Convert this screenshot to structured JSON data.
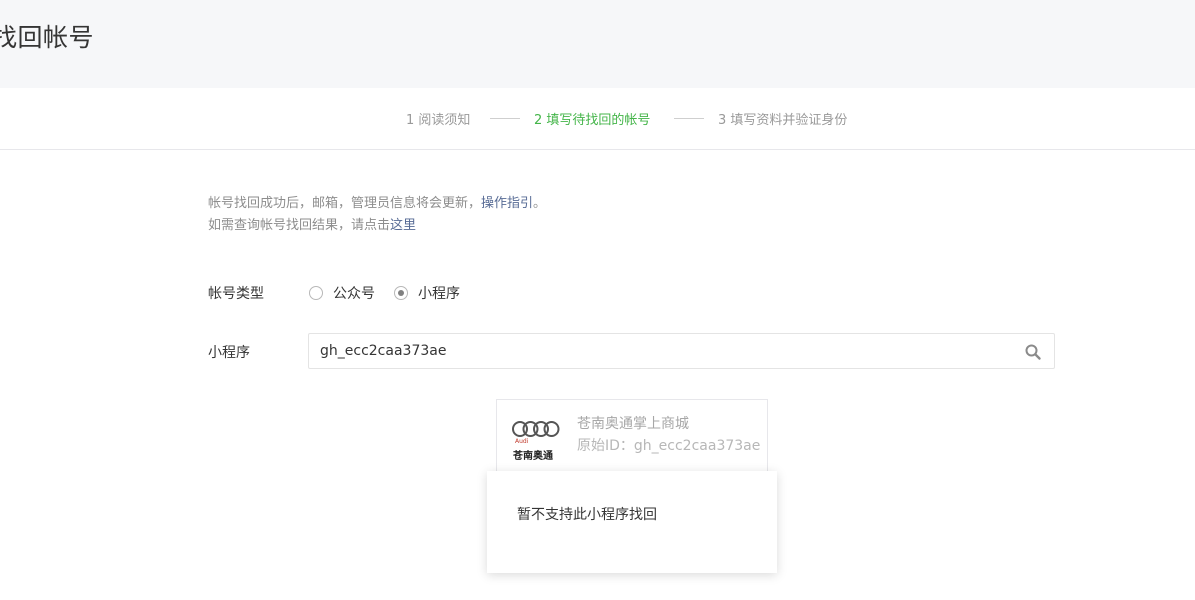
{
  "header": {
    "title": "找回帐号"
  },
  "steps": [
    {
      "label": "1 阅读须知",
      "active": false
    },
    {
      "label": "2 填写待找回的帐号",
      "active": true
    },
    {
      "label": "3 填写资料并验证身份",
      "active": false
    }
  ],
  "tips": {
    "line1_text": "帐号找回成功后，邮箱，管理员信息将会更新，",
    "line1_link": "操作指引",
    "line1_end": "。",
    "line2_text": "如需查询帐号找回结果，请点击",
    "line2_link": "这里"
  },
  "form": {
    "account_type_label": "帐号类型",
    "options": [
      {
        "label": "公众号",
        "checked": false
      },
      {
        "label": "小程序",
        "checked": true
      }
    ],
    "miniprogram_label": "小程序",
    "search_value": "gh_ecc2caa373ae"
  },
  "result_card": {
    "logo_brand": "苍南奥通",
    "logo_small": "Audi",
    "name": "苍南奥通掌上商城",
    "original_id": "原始ID：gh_ecc2caa373ae"
  },
  "popup": {
    "message": "暂不支持此小程序找回"
  }
}
